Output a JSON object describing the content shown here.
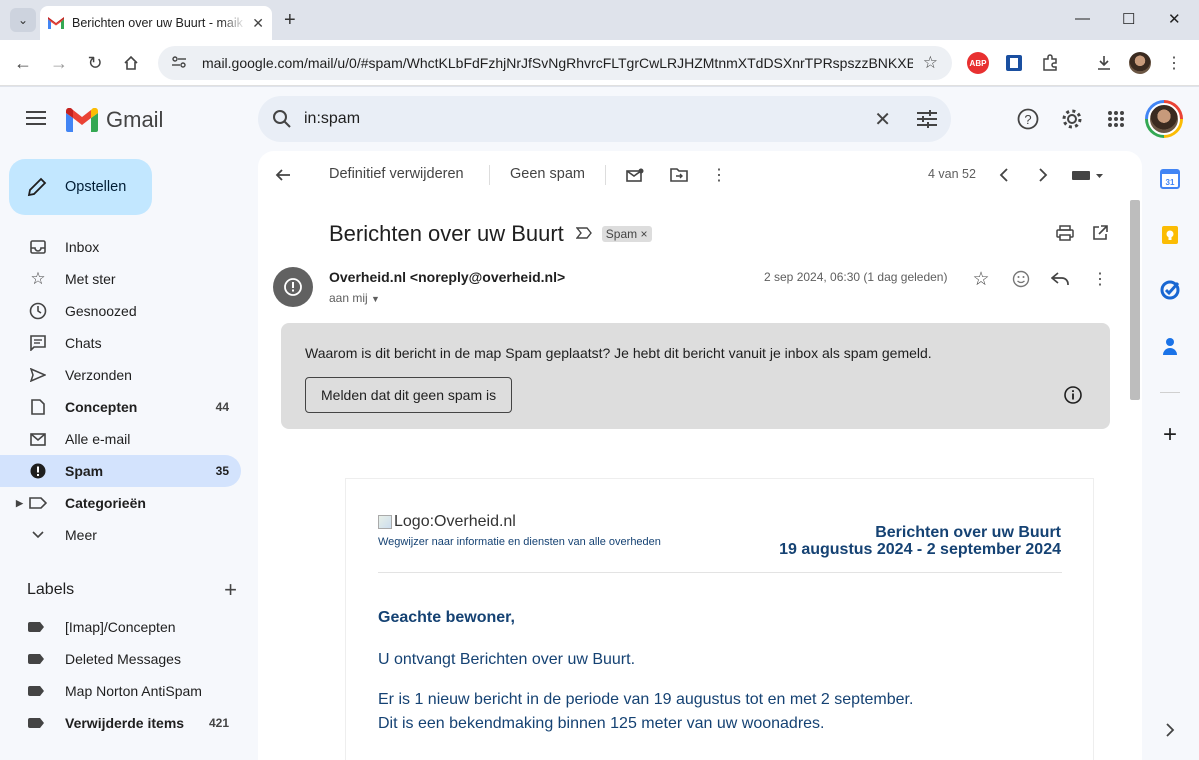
{
  "browser": {
    "tab_title": "Berichten over uw Buurt - maik",
    "url": "mail.google.com/mail/u/0/#spam/WhctKLbFdFzhjNrJfSvNgRhvrcFLTgrCwLRJHZMtnmXTdDSXnrTPRspszzBNKXBtx..."
  },
  "gmail": {
    "logo_text": "Gmail",
    "search_query": "in:spam",
    "compose_label": "Opstellen",
    "nav": [
      {
        "label": "Inbox",
        "count": ""
      },
      {
        "label": "Met ster",
        "count": ""
      },
      {
        "label": "Gesnoozed",
        "count": ""
      },
      {
        "label": "Chats",
        "count": ""
      },
      {
        "label": "Verzonden",
        "count": ""
      },
      {
        "label": "Concepten",
        "count": "44"
      },
      {
        "label": "Alle e-mail",
        "count": ""
      },
      {
        "label": "Spam",
        "count": "35"
      },
      {
        "label": "Categorieën",
        "count": ""
      },
      {
        "label": "Meer",
        "count": ""
      }
    ],
    "labels_heading": "Labels",
    "labels": [
      {
        "label": "[Imap]/Concepten",
        "count": ""
      },
      {
        "label": "Deleted Messages",
        "count": ""
      },
      {
        "label": "Map Norton AntiSpam",
        "count": ""
      },
      {
        "label": "Verwijderde items",
        "count": "421"
      }
    ]
  },
  "message": {
    "delete_forever": "Definitief verwijderen",
    "not_spam": "Geen spam",
    "pager": "4 van 52",
    "subject": "Berichten over uw Buurt",
    "spam_chip": "Spam",
    "spam_chip_close": "×",
    "sender": "Overheid.nl <noreply@overheid.nl>",
    "to": "aan mij",
    "date": "2 sep 2024, 06:30 (1 dag geleden)",
    "banner_question": "Waarom is dit bericht in de map Spam geplaatst?",
    "banner_reason": " Je hebt dit bericht vanuit je inbox als spam gemeld.",
    "banner_button": "Melden dat dit geen spam is"
  },
  "email_body": {
    "logo_alt": "Logo:Overheid.nl",
    "tagline": "Wegwijzer naar informatie en diensten van alle overheden",
    "title_line1": "Berichten over uw Buurt",
    "title_line2": "19 augustus 2024 - 2 september 2024",
    "greeting": "Geachte bewoner,",
    "p1": "U ontvangt Berichten over uw Buurt.",
    "p2_line1": "Er is 1 nieuw bericht in de periode van 19 augustus tot en met 2 september.",
    "p2_line2": "Dit is een bekendmaking binnen 125 meter van uw woonadres."
  }
}
